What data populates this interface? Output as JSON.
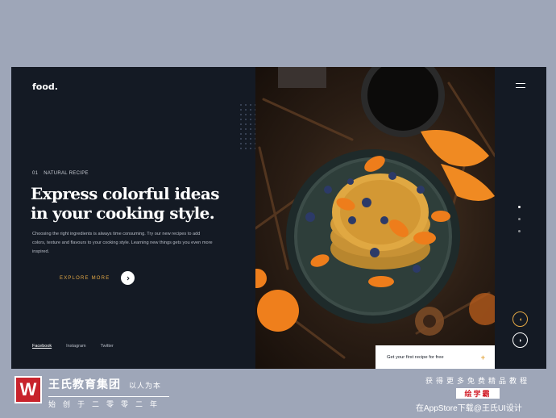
{
  "site": {
    "logo": "food.",
    "eyebrow_number": "01",
    "eyebrow_label": "NATURAL RECIPE",
    "headline_line1": "Express colorful ideas",
    "headline_line2": "in your cooking style.",
    "body": "Choosing the right ingredients is always time consuming. Try our new recipes to add colors, texture and flavours to your cooking style. Learning new things gets you even more inspired.",
    "cta_label": "EXPLORE MORE",
    "social": [
      "Facebook",
      "Instagram",
      "Twitter"
    ],
    "card_label": "Get your first recipe for free",
    "card_plus": "+"
  },
  "icons": {
    "cta_arrow": "arrow-right-icon",
    "prev": "chevron-left-icon",
    "next": "chevron-right-icon",
    "menu": "hamburger-menu-icon"
  },
  "pager": {
    "count": 3,
    "active_index": 0
  },
  "watermark": {
    "brand_mark": "W",
    "brand_name": "王氏教育集团",
    "brand_slogan": "以人为本",
    "brand_sub": "始创于二零零二年",
    "promo_line1": "获得更多免费精品教程",
    "promo_badge": "绘学霸",
    "promo_line3": "在AppStore下载@王氏UI设计"
  },
  "colors": {
    "page_bg": "#9ea6b8",
    "panel_bg": "#141a24",
    "accent": "#e4a845",
    "text_primary": "#ffffff",
    "brand_red": "#c8232c"
  }
}
